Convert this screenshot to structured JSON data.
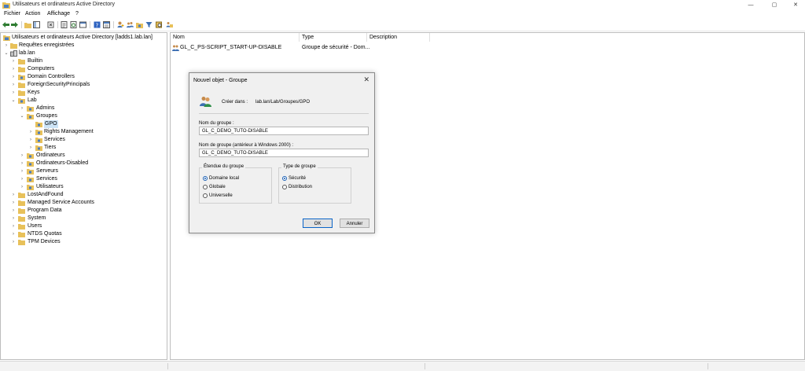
{
  "window": {
    "title": "Utilisateurs et ordinateurs Active Directory",
    "controls": {
      "minimize": "—",
      "maximize": "▢",
      "close": "✕"
    }
  },
  "menu": [
    "Fichier",
    "Action",
    "Affichage",
    "?"
  ],
  "tree": {
    "root": "Utilisateurs et ordinateurs Active Directory [ladds1.lab.lan]",
    "items": [
      "Requêtes enregistrées",
      "lab.lan",
      "Builtin",
      "Computers",
      "Domain Controllers",
      "ForeignSecurityPrincipals",
      "Keys",
      "Lab",
      "Admins",
      "Groupes",
      "GPO",
      "Rights Management",
      "Services",
      "Tiers",
      "Ordinateurs",
      "Ordinateurs-Disabled",
      "Serveurs",
      "Services",
      "Utilisateurs",
      "LostAndFound",
      "Managed Service Accounts",
      "Program Data",
      "System",
      "Users",
      "NTDS Quotas",
      "TPM Devices"
    ]
  },
  "list": {
    "columns": [
      "Nom",
      "Type",
      "Description"
    ],
    "rows": [
      {
        "name": "GL_C_PS-SCRIPT_START-UP-DISABLE",
        "type": "Groupe de sécurité - Dom...",
        "description": ""
      }
    ]
  },
  "dialog": {
    "title": "Nouvel objet - Groupe",
    "close": "✕",
    "create_in_label": "Créer dans :",
    "create_in_path": "lab.lan/Lab/Groupes/GPO",
    "group_name_label": "Nom du groupe :",
    "group_name_value": "GL_C_DEMO_TUTO-DISABLE",
    "pre2000_label": "Nom de groupe (antérieur à Windows 2000) :",
    "pre2000_value": "GL_C_DEMO_TUTO-DISABLE",
    "scope": {
      "label": "Étendue du groupe",
      "options": [
        "Domaine local",
        "Globale",
        "Universelle"
      ],
      "selected": "Domaine local"
    },
    "type": {
      "label": "Type de groupe",
      "options": [
        "Sécurité",
        "Distribution"
      ],
      "selected": "Sécurité"
    },
    "ok": "OK",
    "cancel": "Annuler"
  },
  "colors": {
    "accent": "#1a5fb4",
    "folder": "#e8c15a",
    "selection": "#cce4f7"
  }
}
